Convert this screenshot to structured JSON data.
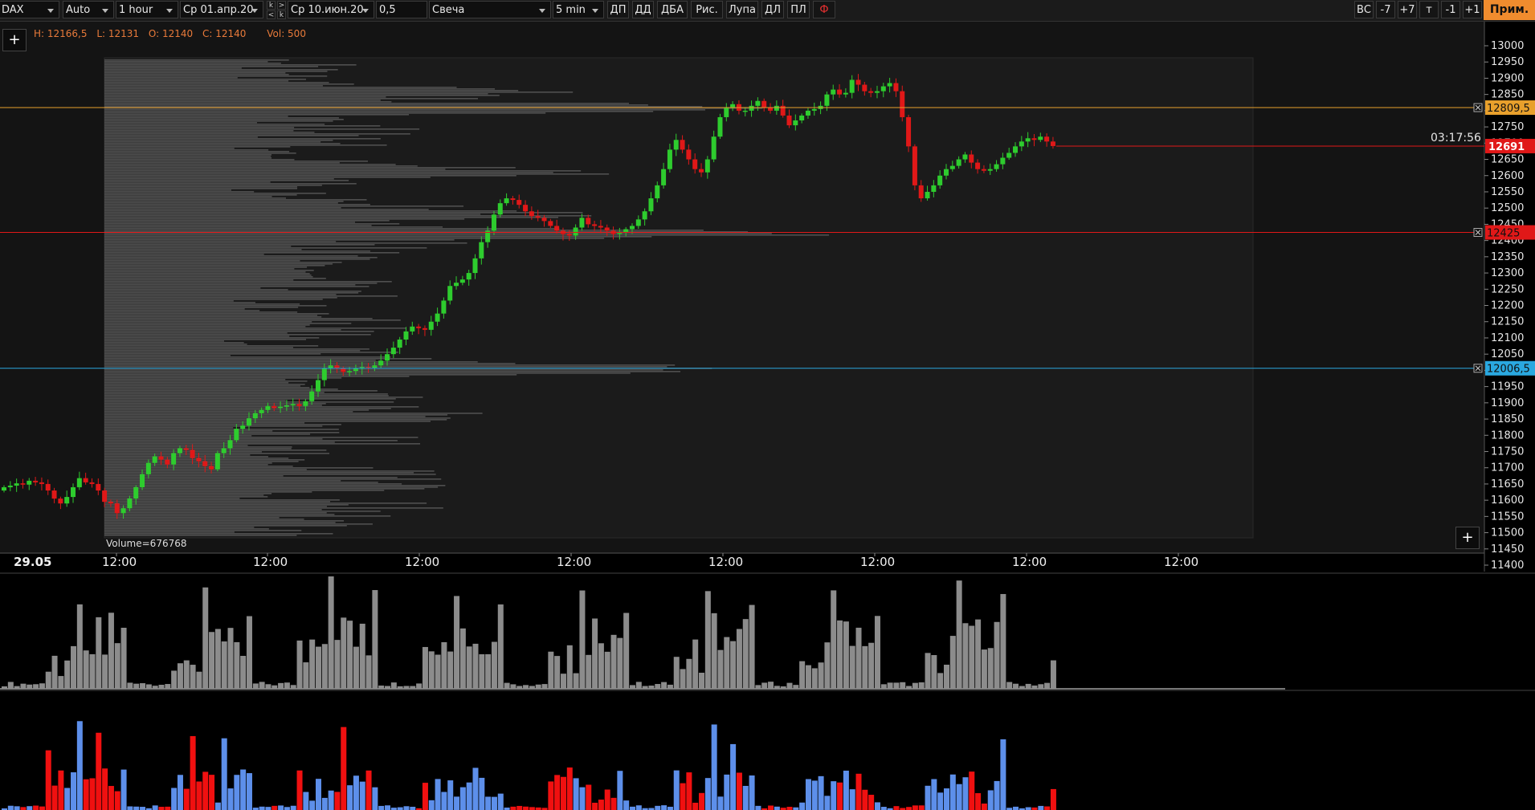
{
  "toolbar": {
    "symbol": "DAX",
    "scale_mode": "Auto",
    "timeframe": "1 hour",
    "date_from": "Ср 01.апр.20",
    "date_to": "Ср 10.июн.20",
    "step": "0,5",
    "chart_style": "Свеча",
    "profile_period": "5 min",
    "buttons": [
      "ДП",
      "ДД",
      "ДБА",
      "Рис.",
      "Лупа",
      "ДЛ",
      "ПЛ",
      "Ф"
    ],
    "right_buttons": [
      "ВС",
      "-7",
      "+7",
      "т",
      "-1",
      "+1"
    ],
    "apply_label": "Прим.",
    "nav_small": [
      "k",
      ">",
      "<",
      "k"
    ]
  },
  "ohlc": {
    "h": "H: 12166,5",
    "l": "L: 12131",
    "o": "O: 12140",
    "c": "C: 12140",
    "vol": "Vol: 500"
  },
  "colors": {
    "up": "#2ecc2e",
    "down": "#e01818",
    "orange": "#e8a02c",
    "red": "#e01818",
    "cyan": "#2aa8e0",
    "vol_gray": "#8c8c8c",
    "delta_blue": "#5d8fea",
    "delta_red": "#f01010"
  },
  "price_lines": [
    {
      "value": 12809.5,
      "label": "12809,5",
      "color": "#e8a02c"
    },
    {
      "value": 12425,
      "label": "12425",
      "color": "#e01818"
    },
    {
      "value": 12006.5,
      "label": "12006,5",
      "color": "#2aa8e0"
    }
  ],
  "current_price": {
    "value": 12691,
    "label": "12691",
    "timer": "03:17:56"
  },
  "volume_label": "Volume=676768",
  "date_label": "29.05",
  "plus_label": "+",
  "chart_data": [
    {
      "type": "candlestick",
      "y_axis": {
        "min": 11400,
        "max": 13000,
        "ticks": [
          11400,
          11450,
          11500,
          11550,
          11600,
          11650,
          11700,
          11750,
          11800,
          11850,
          11900,
          11950,
          12000,
          12050,
          12100,
          12150,
          12200,
          12250,
          12300,
          12350,
          12400,
          12450,
          12500,
          12550,
          12600,
          12650,
          12700,
          12750,
          12800,
          12850,
          12900,
          12950,
          13000
        ]
      },
      "x_tick_labels": [
        "29.05",
        "12:00",
        "12:00",
        "12:00",
        "12:00",
        "12:00",
        "12:00",
        "12:00",
        "12:00"
      ],
      "closes": [
        11640,
        11645,
        11652,
        11648,
        11660,
        11655,
        11650,
        11630,
        11605,
        11590,
        11610,
        11640,
        11668,
        11655,
        11650,
        11630,
        11595,
        11590,
        11560,
        11575,
        11605,
        11640,
        11680,
        11715,
        11735,
        11725,
        11710,
        11745,
        11760,
        11755,
        11730,
        11720,
        11705,
        11695,
        11745,
        11760,
        11785,
        11820,
        11830,
        11852,
        11868,
        11878,
        11890,
        11884,
        11888,
        11892,
        11896,
        11890,
        11905,
        11935,
        11970,
        12005,
        12015,
        12005,
        11995,
        11998,
        12005,
        12010,
        12008,
        12015,
        12030,
        12050,
        12070,
        12095,
        12120,
        12135,
        12130,
        12125,
        12150,
        12175,
        12215,
        12260,
        12270,
        12280,
        12300,
        12345,
        12395,
        12430,
        12480,
        12515,
        12530,
        12525,
        12510,
        12490,
        12475,
        12470,
        12460,
        12445,
        12430,
        12420,
        12415,
        12440,
        12470,
        12450,
        12445,
        12440,
        12430,
        12420,
        12425,
        12435,
        12445,
        12465,
        12490,
        12530,
        12570,
        12620,
        12680,
        12710,
        12680,
        12650,
        12620,
        12610,
        12650,
        12720,
        12780,
        12810,
        12820,
        12800,
        12800,
        12815,
        12830,
        12810,
        12800,
        12815,
        12785,
        12755,
        12770,
        12785,
        12800,
        12805,
        12815,
        12850,
        12865,
        12850,
        12855,
        12895,
        12880,
        12860,
        12855,
        12860,
        12875,
        12885,
        12860,
        12780,
        12690,
        12570,
        12530,
        12550,
        12570,
        12600,
        12620,
        12630,
        12650,
        12665,
        12640,
        12620,
        12615,
        12620,
        12635,
        12655,
        12670,
        12690,
        12705,
        12715,
        12710,
        12720,
        12705,
        12691
      ]
    },
    {
      "type": "bar",
      "name": "volume"
    },
    {
      "type": "bar",
      "name": "delta"
    }
  ]
}
